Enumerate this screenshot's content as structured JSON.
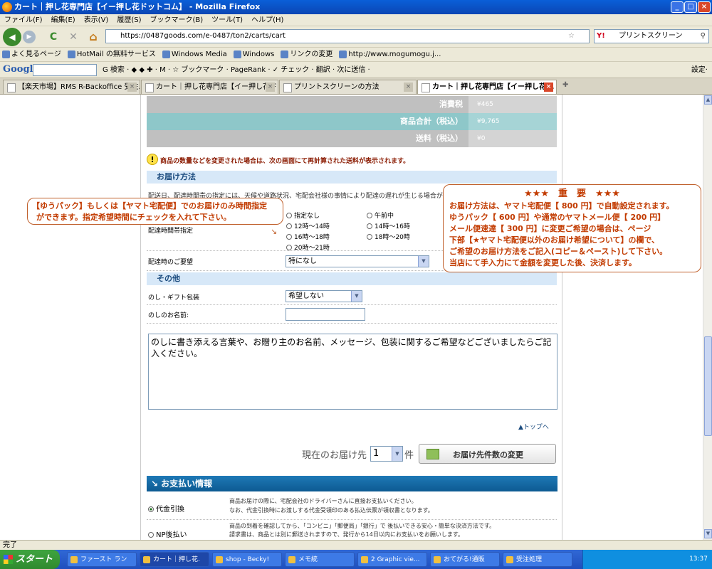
{
  "window": {
    "title": "カート｜押し花専門店【イー押し花ドットコム】 - Mozilla Firefox",
    "min_label": "_",
    "max_label": "□",
    "close_label": "×"
  },
  "menu": [
    "ファイル(F)",
    "編集(E)",
    "表示(V)",
    "履歴(S)",
    "ブックマーク(B)",
    "ツール(T)",
    "ヘルプ(H)"
  ],
  "nav": {
    "url": "https://0487goods.com/e-0487/ton2/carts/cart",
    "search_value": "プリントスクリーン",
    "search_engine": "Y!",
    "back_glyph": "◀",
    "forward_glyph": "▶",
    "reload_glyph": "C",
    "stop_glyph": "✕",
    "home_glyph": "⌂",
    "star_glyph": "☆",
    "magnifier_glyph": "⚲"
  },
  "bookmarks": [
    "よく見るページ",
    "HotMail の無料サービス",
    "Windows Media",
    "Windows",
    "リンクの変更",
    "http://www.mogumogu.j..."
  ],
  "google": {
    "logo": "Google",
    "text": "G 検索 · ◆ ◆ ✚ · M · ☆ ブックマーク · PageRank · ✓ チェック · 翻訳 · 次に送信 ·",
    "settings": "設定·"
  },
  "tabs": [
    "【楽天市場】RMS R-Backoffice 受注.",
    "カート｜押し花専門店【イー押し花ドット.",
    "プリントスクリーンの方法",
    "カート｜押し花専門店【イー押し花..."
  ],
  "summary": [
    {
      "label": "消費税",
      "value": "¥465"
    },
    {
      "label": "商品合計（税込）",
      "value": "¥9,765"
    },
    {
      "label": "送料（税込）",
      "value": "¥0"
    }
  ],
  "notice": "商品の数量などを変更された場合は、次の画面にて再計算された送料が表示されます。",
  "delivery": {
    "header": "お届け方法",
    "note": "配送日、配達時間帯の指定には、天候や道路状況、宅配会社様の事情により配達の遅れが生じる場合がございます。",
    "time_label": "配達時間帯指定",
    "time_options": [
      "指定なし",
      "午前中",
      "12時〜14時",
      "14時〜16時",
      "16時〜18時",
      "18時〜20時",
      "20時〜21時"
    ],
    "request_label": "配達時のご要望",
    "request_value": "特になし"
  },
  "other": {
    "header": "その他",
    "gift_label": "のし・ギフト包装",
    "gift_value": "希望しない",
    "name_label": "のしのお名前:",
    "textarea": "のしに書き添える言葉や、お贈り主のお名前、メッセージ、包装に関するご希望などございましたらご記入ください。"
  },
  "callout_left": {
    "line1": "【ゆうパック】もしくは【ヤマト宅配便】でのお届けのみ時間指定",
    "line2": "ができます。指定希望時間にチェックを入れて下さい。"
  },
  "callout_right": {
    "title": "★★★　重　要　★★★",
    "lines": [
      "お届け方法は、ヤマト宅配便【 800 円】で自動設定されます。",
      "ゆうパック【 600 円】や通常のヤマトメール便【 200 円】",
      "メール便速達【 300 円】に変更ご希望の場合は、ページ",
      "下部【★ヤマト宅配便以外のお届け希望について】の欄で、",
      "ご希望のお届け方法をご記入(コピー＆ペースト)して下さい。",
      "当店にて手入力にて金額を変更した後、決済します。"
    ]
  },
  "totop": "▲トップへ",
  "dest": {
    "prefix": "現在のお届け先",
    "count": "1",
    "suffix": "件",
    "button": "お届け先件数の変更"
  },
  "payment": {
    "header": "お支払い情報",
    "options": [
      {
        "label": "代金引換",
        "selected": true,
        "desc1": "商品お届けの際に、宅配会社のドライバーさんに直接お支払いください。",
        "desc2": "なお、代金引換時にお渡しする代金受領印のある払込伝票が領収書となります。"
      },
      {
        "label": "NP後払い",
        "selected": false,
        "desc1": "商品の到着を確認してから、「コンビニ」「郵便局」「銀行」で 後払いできる安心・簡単な決済方法です。",
        "desc2": "請求書は、商品とは別に郵送されますので、発行から14日以内にお支払いをお願いします。"
      }
    ]
  },
  "status": "完了",
  "taskbar": {
    "start": "スタート",
    "items": [
      "ファースト ラン",
      "カート｜押し花.",
      "shop - Becky!",
      "メモ統",
      "2 Graphic vie...",
      "おてがる!通販",
      "受注処理"
    ],
    "clock": "13:37"
  },
  "colors": {
    "summary_gray": "#c0c0c0",
    "summary_teal": "#8ec7c9",
    "section_blue": "#d7e8f8",
    "callout_orange": "#c23b00"
  }
}
